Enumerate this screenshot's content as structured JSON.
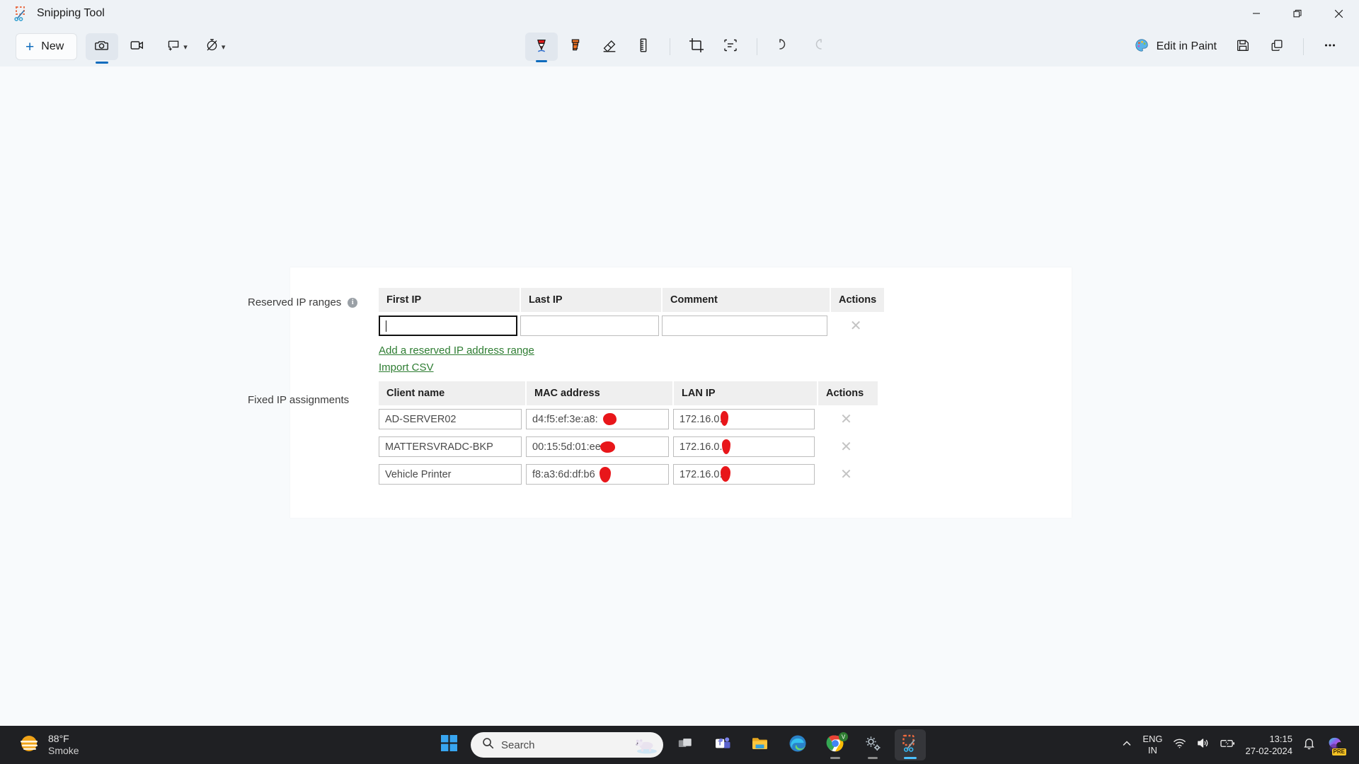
{
  "window": {
    "title": "Snipping Tool",
    "app_icon": "snipping-tool-icon",
    "controls": {
      "minimize": "—",
      "restore": "❐",
      "close": "✕"
    }
  },
  "toolbar": {
    "new_label": "New",
    "new_plus": "+",
    "mode_snapshot": "camera-icon",
    "mode_record": "video-camera-icon",
    "shape_label": "shape-picker",
    "delay_label": "delay-picker",
    "tools": [
      {
        "name": "ballpoint-pen-icon",
        "active": true
      },
      {
        "name": "highlighter-icon",
        "active": false
      },
      {
        "name": "eraser-icon",
        "active": false
      },
      {
        "name": "ruler-icon",
        "active": false
      },
      {
        "name": "crop-icon",
        "active": false
      },
      {
        "name": "text-actions-icon",
        "active": false
      },
      {
        "name": "undo-icon",
        "active": false
      },
      {
        "name": "redo-icon",
        "active": false
      }
    ],
    "edit_in_paint": "Edit in Paint",
    "save_icon": "save-icon",
    "copy_icon": "copy-icon",
    "more_icon": "more-options-icon"
  },
  "snip": {
    "reserved": {
      "label": "Reserved IP ranges",
      "info": "i",
      "columns": [
        "First IP",
        "Last IP",
        "Comment",
        "Actions"
      ],
      "rows": [
        {
          "first_ip": "",
          "last_ip": "",
          "comment": "",
          "action": "✕"
        }
      ],
      "links": [
        "Add a reserved IP address range",
        "Import CSV"
      ]
    },
    "fixed": {
      "label": "Fixed IP assignments",
      "columns": [
        "Client name",
        "MAC address",
        "LAN IP",
        "Actions"
      ],
      "rows": [
        {
          "client": "AD-SERVER02",
          "mac": "d4:f5:ef:3e:a8:",
          "lan_ip": "172.16.0.",
          "action": "✕"
        },
        {
          "client": "MATTERSVRADC-BKP",
          "mac": "00:15:5d:01:ee",
          "lan_ip": "172.16.0.",
          "action": "✕"
        },
        {
          "client": "Vehicle Printer",
          "mac": "f8:a3:6d:df:b6",
          "lan_ip": "172.16.0.",
          "action": "✕"
        }
      ]
    },
    "redaction_color": "#e8161a",
    "link_color": "#2e7d32",
    "header_bg": "#efefef"
  },
  "taskbar": {
    "weather_temp": "88°F",
    "weather_cond": "Smoke",
    "weather_icon": "haze-sun-icon",
    "start_icon": "windows-start-icon",
    "search_placeholder": "Search",
    "search_icon": "search-icon",
    "search_glyph": "polar-bear-icon",
    "apps": [
      {
        "name": "task-view-icon",
        "running": false,
        "active": false
      },
      {
        "name": "microsoft-teams-icon",
        "running": false,
        "active": false
      },
      {
        "name": "file-explorer-icon",
        "running": false,
        "active": false
      },
      {
        "name": "microsoft-edge-icon",
        "running": false,
        "active": false
      },
      {
        "name": "google-chrome-icon",
        "running": true,
        "active": false
      },
      {
        "name": "settings-icon",
        "running": true,
        "active": false
      },
      {
        "name": "snipping-tool-icon",
        "running": true,
        "active": true
      }
    ],
    "tray_chevron": "show-hidden-icons",
    "lang_line1": "ENG",
    "lang_line2": "IN",
    "wifi_icon": "wifi-icon",
    "volume_icon": "speaker-icon",
    "battery_icon": "battery-charging-icon",
    "time": "13:15",
    "date": "27-02-2024",
    "notif_icon": "bell-icon",
    "copilot_icon": "copilot-preview-icon",
    "copilot_badge": "PRE"
  }
}
